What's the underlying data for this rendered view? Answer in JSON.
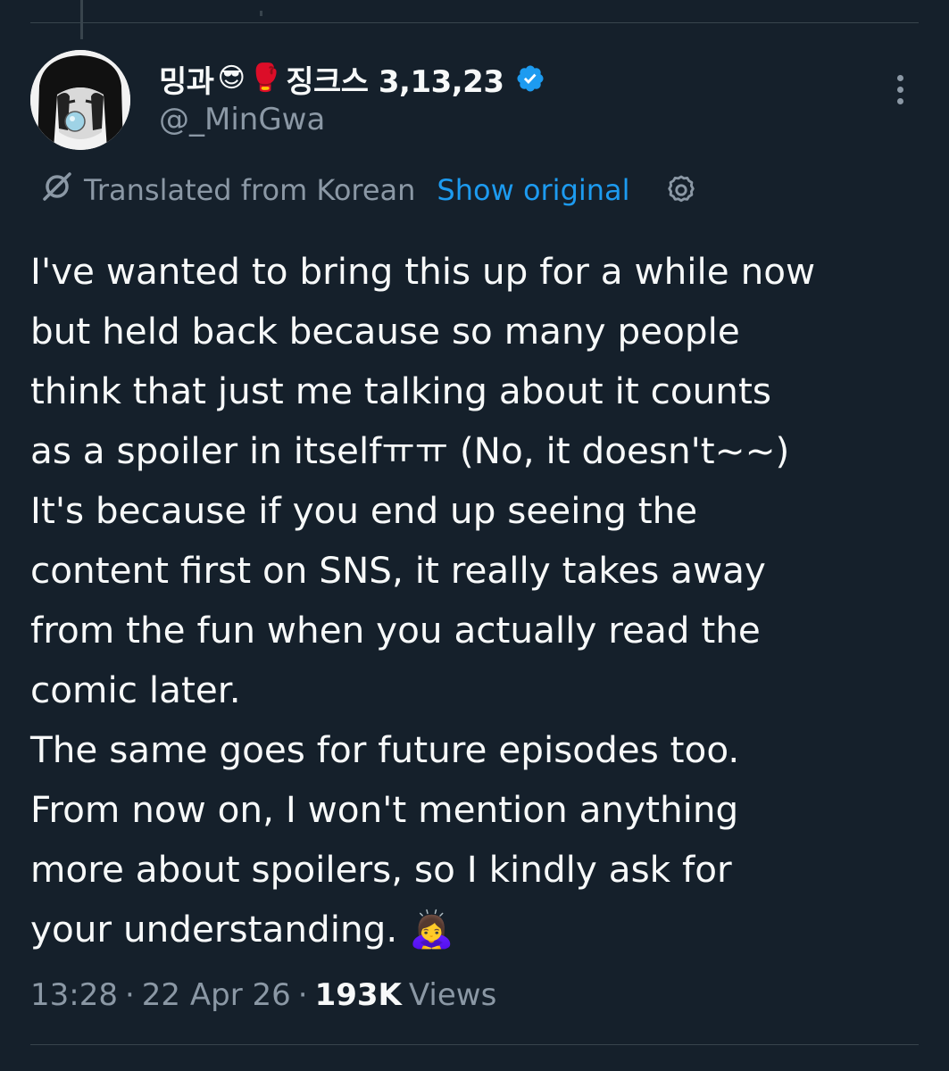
{
  "author": {
    "display_name_prefix": "밍과",
    "emoji_1": "😎",
    "emoji_2": "🥊",
    "display_name_suffix": "징크스 3,13,23",
    "handle": "@_MinGwa"
  },
  "translation": {
    "label": "Translated from Korean",
    "show_original": "Show original"
  },
  "tweet": {
    "lines": [
      "I've wanted to bring this up for a while now",
      "but held back because so many people",
      "think that just me talking about it counts",
      "as a spoiler in itselfㅠㅠ (No, it doesn't~~)",
      "It's because if you end up seeing the",
      "content first on SNS, it really takes away",
      "from the fun when you actually read the",
      "comic later.",
      "The same goes for future episodes too.",
      "From now on, I won't mention anything",
      "more about spoilers, so I kindly ask for",
      "your understanding."
    ],
    "end_emoji": "🙇‍♀️"
  },
  "meta": {
    "time": "13:28",
    "date": "22 Apr 26",
    "views_count": "193K",
    "views_label": "Views"
  },
  "colors": {
    "background": "#15202b",
    "text": "#f7f9f9",
    "secondary": "#8b98a5",
    "link": "#1d9bf0",
    "divider": "#38444d"
  },
  "icons": {
    "verified": "verified-badge-icon",
    "translate": "translate-slash-icon",
    "settings": "gear-icon",
    "more": "more-vertical-icon"
  }
}
